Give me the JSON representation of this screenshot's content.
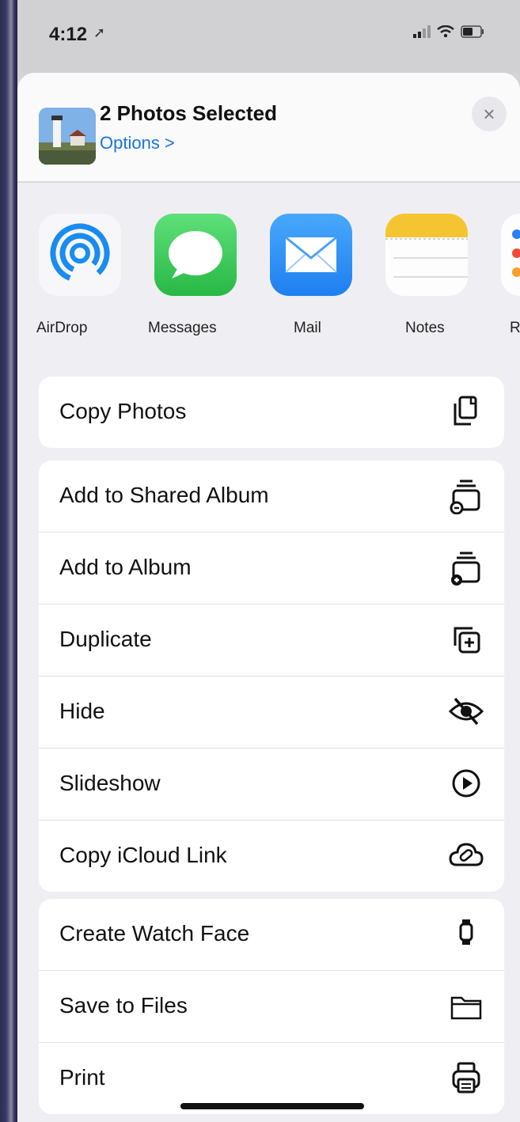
{
  "status": {
    "time": "4:12"
  },
  "header": {
    "title": "2 Photos Selected",
    "options_label": "Options >",
    "close_symbol": "×"
  },
  "apps": [
    {
      "label": "AirDrop",
      "icon": "airdrop-icon"
    },
    {
      "label": "Messages",
      "icon": "messages-icon"
    },
    {
      "label": "Mail",
      "icon": "mail-icon"
    },
    {
      "label": "Notes",
      "icon": "notes-icon"
    },
    {
      "label": "Re",
      "icon": "reminders-icon"
    }
  ],
  "groups": [
    {
      "rows": [
        {
          "label": "Copy Photos",
          "icon": "copy-icon"
        }
      ]
    },
    {
      "rows": [
        {
          "label": "Add to Shared Album",
          "icon": "shared-album-icon"
        },
        {
          "label": "Add to Album",
          "icon": "add-album-icon"
        },
        {
          "label": "Duplicate",
          "icon": "duplicate-icon"
        },
        {
          "label": "Hide",
          "icon": "hide-icon"
        },
        {
          "label": "Slideshow",
          "icon": "slideshow-icon"
        },
        {
          "label": "Copy iCloud Link",
          "icon": "icloud-link-icon"
        }
      ]
    },
    {
      "rows": [
        {
          "label": "Create Watch Face",
          "icon": "watch-icon"
        },
        {
          "label": "Save to Files",
          "icon": "folder-icon"
        },
        {
          "label": "Print",
          "icon": "printer-icon"
        }
      ]
    }
  ],
  "colors": {
    "accent": "#1a73e8",
    "messages_green": "#3ccb5a",
    "mail_blue": "#2e8ff5",
    "notes_yellow": "#f5c531"
  }
}
